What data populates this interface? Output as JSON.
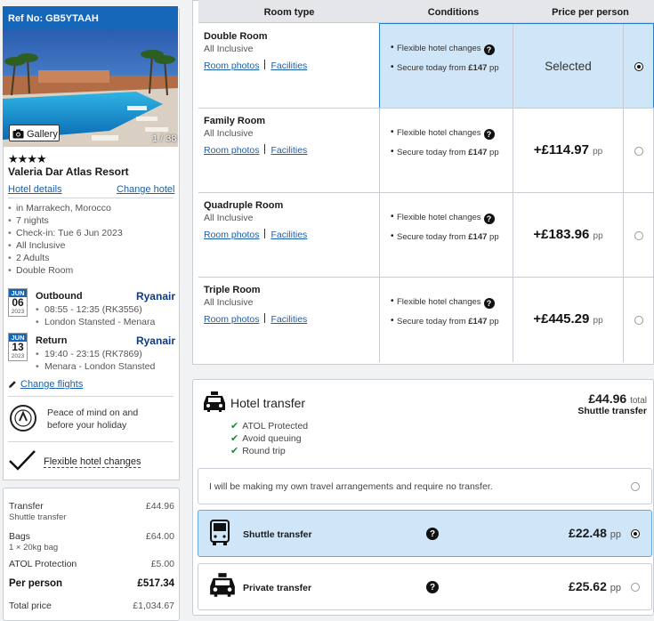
{
  "hotel": {
    "ref": "Ref No: GB5YTAAH",
    "gallery_label": "Gallery",
    "photo_count": "1 / 38",
    "stars": "★★★★",
    "name": "Valeria Dar Atlas Resort",
    "details_link": "Hotel details",
    "change_link": "Change hotel",
    "facts": [
      "in Marrakech, Morocco",
      "7 nights",
      "Check-in: Tue 6 Jun 2023",
      "All Inclusive",
      "2 Adults",
      "Double Room"
    ]
  },
  "flights": {
    "outbound": {
      "month": "JUN",
      "day": "06",
      "year": "2023",
      "title": "Outbound",
      "airline": "Ryanair",
      "time": "08:55 - 12:35 (RK3556)",
      "route": "London Stansted - Menara"
    },
    "return": {
      "month": "JUN",
      "day": "13",
      "year": "2023",
      "title": "Return",
      "airline": "Ryanair",
      "time": "19:40 - 23:15 (RK7869)",
      "route": "Menara - London Stansted"
    },
    "change_link": "Change flights"
  },
  "atol": {
    "line1": "Peace of mind on and",
    "line2": "before your holiday"
  },
  "flex": {
    "label": "Flexible hotel changes"
  },
  "price_summary": {
    "transfer_label": "Transfer",
    "transfer_sub": "Shuttle transfer",
    "transfer_value": "£44.96",
    "bags_label": "Bags",
    "bags_sub": "1 × 20kg bag",
    "bags_value": "£64.00",
    "atol_label": "ATOL Protection",
    "atol_value": "£5.00",
    "pp_label": "Per person",
    "pp_value": "£517.34",
    "total_label": "Total price",
    "total_value": "£1,034.67"
  },
  "room_table": {
    "headers": {
      "room_type": "Room type",
      "conditions": "Conditions",
      "price": "Price per person"
    },
    "link_photos": "Room photos",
    "link_facilities": "Facilities",
    "cond1": "Flexible hotel changes",
    "cond2_prefix": "Secure today from ",
    "cond2_amount": "£147",
    "cond2_suffix": " pp",
    "selected_label": "Selected",
    "pp": "pp",
    "rooms": [
      {
        "name": "Double Room",
        "board": "All Inclusive",
        "price": ""
      },
      {
        "name": "Family Room",
        "board": "All Inclusive",
        "price": "+£114.97"
      },
      {
        "name": "Quadruple Room",
        "board": "All Inclusive",
        "price": "+£183.96"
      },
      {
        "name": "Triple Room",
        "board": "All Inclusive",
        "price": "+£445.29"
      }
    ]
  },
  "transfer": {
    "title": "Hotel transfer",
    "total": "£44.96",
    "total_suffix": "total",
    "total_sub": "Shuttle transfer",
    "features": [
      "ATOL Protected",
      "Avoid queuing",
      "Round trip"
    ],
    "no_transfer": "I will be making my own travel arrangements and require no transfer.",
    "shuttle_label": "Shuttle transfer",
    "shuttle_price": "£22.48",
    "private_label": "Private transfer",
    "private_price": "£25.62",
    "pp": "pp"
  },
  "colors": {
    "brand_blue": "#1565b8",
    "selected_bg": "#cfe5f8",
    "link": "#1a5fa8",
    "check": "#1d8a3a"
  }
}
